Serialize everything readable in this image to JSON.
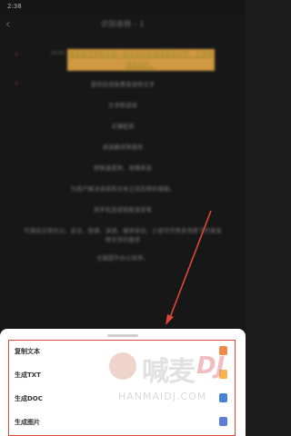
{
  "status": {
    "time": "2:38"
  },
  "appbar": {
    "title": "识别音频 - 1"
  },
  "doc": {
    "first_line": {
      "time": "00:00",
      "text": "录音转文字助手是一款专业的在线语音转文字，文字转语音软件。"
    },
    "lines": [
      "提供在线免费录音转文字",
      "文字转语音",
      "主播配音",
      "语音翻译等服务",
      "转换速度快，准确率高",
      "为用户解决语音和文本之间互转的难题。",
      "将手机变成智能录音笔",
      "可满足日常办公、会议、授课、演讲、媒体采访、小说写作等多场景下的录音转文字的需求",
      "全面提升办公效率。"
    ]
  },
  "sheet": {
    "items": [
      {
        "label": "复制文本",
        "icon": "copy-icon",
        "color": "#f08a4b"
      },
      {
        "label": "生成TXT",
        "icon": "txt-file-icon",
        "color": "#f6b44e"
      },
      {
        "label": "生成DOC",
        "icon": "doc-file-icon",
        "color": "#4a83d6"
      },
      {
        "label": "生成图片",
        "icon": "image-icon",
        "color": "#5b7fd1"
      }
    ]
  },
  "watermark": {
    "brand": "喊麦",
    "dj": "DJ",
    "site": "HANMAIDJ.COM"
  },
  "colors": {
    "accent_red": "#e0463a",
    "highlight_yellow": "#b5a12e"
  }
}
